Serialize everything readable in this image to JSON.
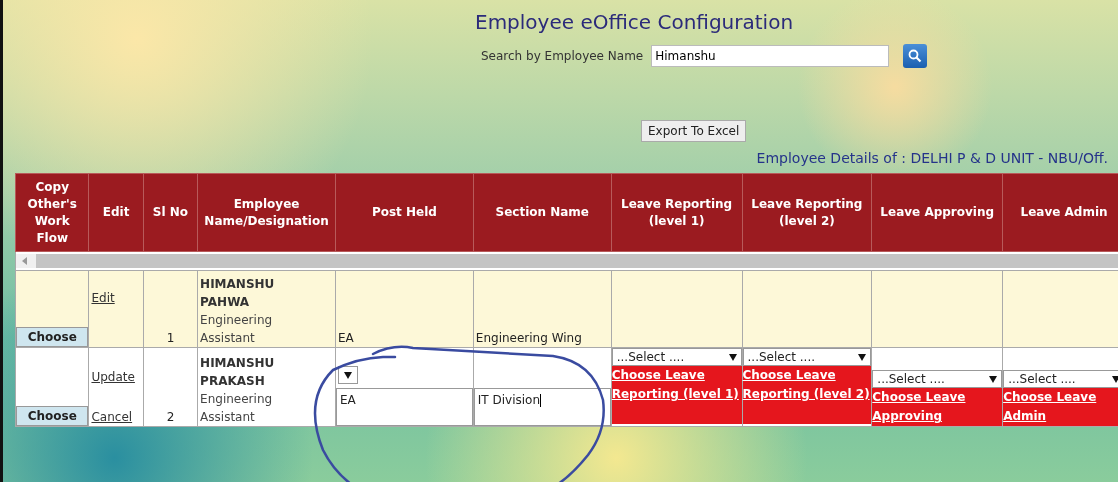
{
  "title": "Employee eOffice Configuration",
  "search": {
    "label": "Search by Employee Name",
    "value": "Himanshu"
  },
  "export_button": "Export To Excel",
  "details_text": "Employee Details of : DELHI P & D UNIT - NBU/Off.",
  "table": {
    "columns": [
      "Copy Other's Work Flow",
      "Edit",
      "Sl No",
      "Employee Name/Designation",
      "Post Held",
      "Section Name",
      "Leave Reporting (level 1)",
      "Leave Reporting (level 2)",
      "Leave Approving",
      "Leave Admin"
    ],
    "rows": [
      {
        "kind": "view",
        "choose": "Choose",
        "actions": [
          "Edit"
        ],
        "sl_no": "1",
        "name": "HIMANSHU PAHWA",
        "designation": "Engineering Assistant",
        "post_held": "EA",
        "section": "Engineering Wing"
      },
      {
        "kind": "edit",
        "choose": "Choose",
        "actions": [
          "Update",
          "Cancel"
        ],
        "sl_no": "2",
        "name": "HIMANSHU PRAKASH",
        "designation": "Engineering Assistant",
        "post_held": "EA",
        "section": "IT Division",
        "leave": [
          {
            "select": "...Select ....",
            "link": "Choose Leave Reporting (level 1)"
          },
          {
            "select": "...Select ....",
            "link": "Choose Leave Reporting (level 2)"
          },
          {
            "select": "...Select ....",
            "link": "Choose Leave Approving"
          },
          {
            "select": "...Select ....",
            "link": "Choose Leave Admin"
          }
        ]
      }
    ]
  }
}
